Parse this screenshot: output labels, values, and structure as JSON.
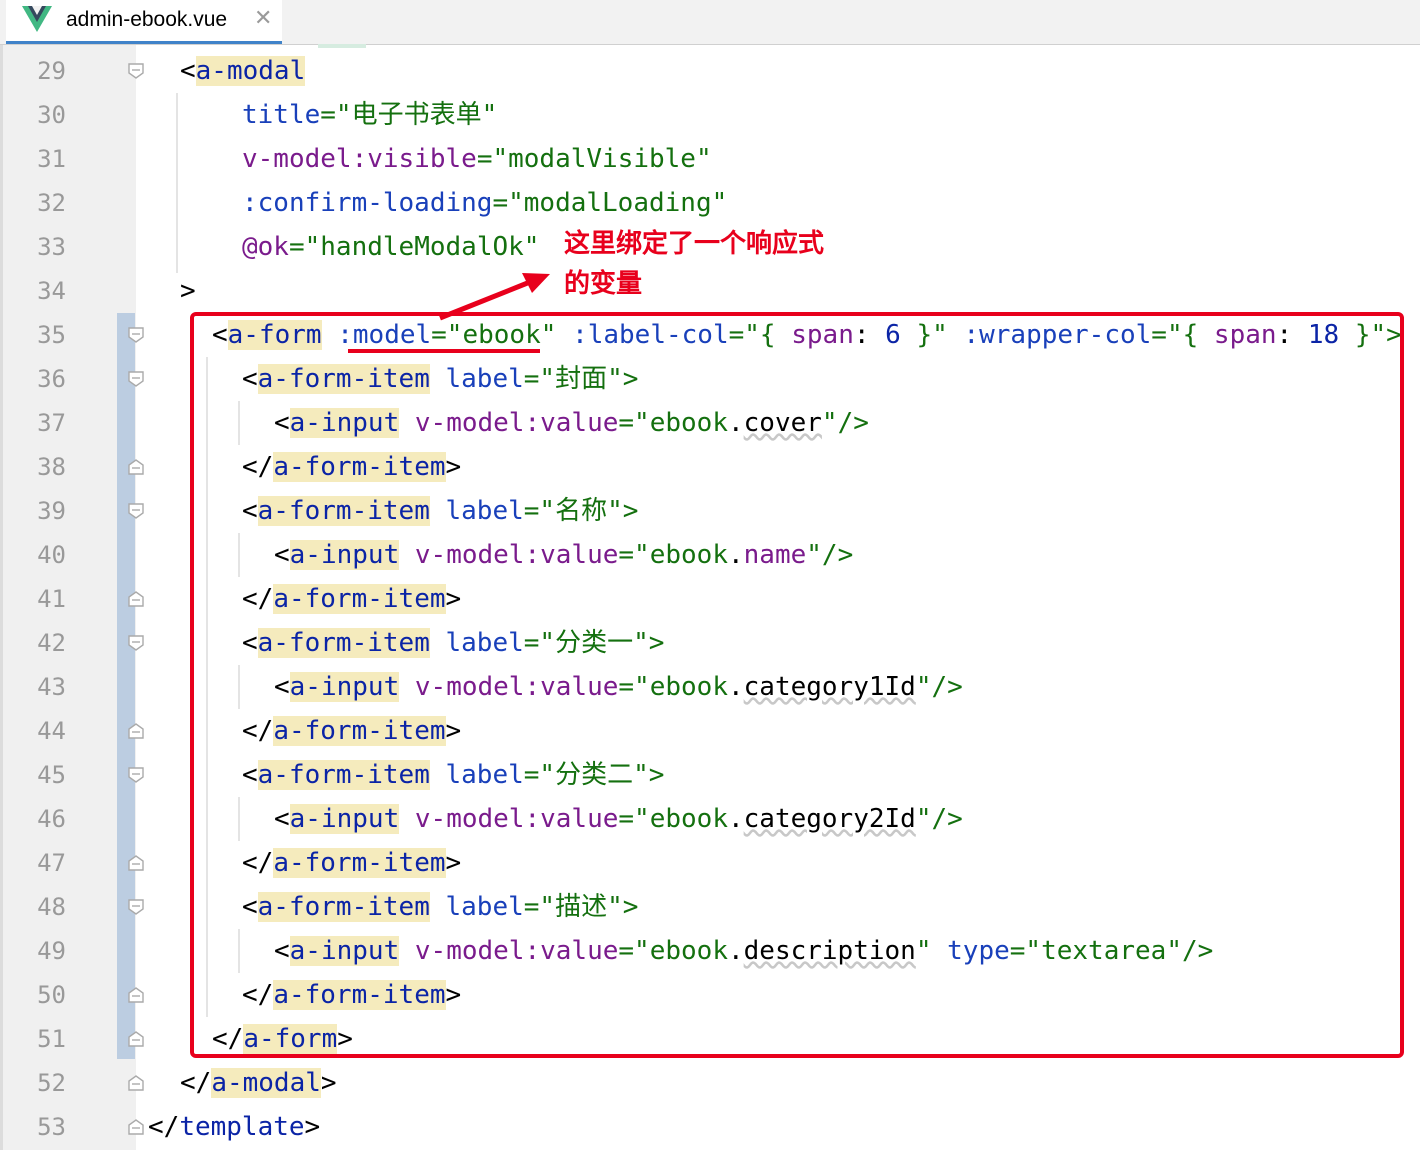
{
  "tab": {
    "filename": "admin-ebook.vue",
    "close": "✕",
    "icon": "vue-logo-icon"
  },
  "line_numbers": [
    "29",
    "30",
    "31",
    "32",
    "33",
    "34",
    "35",
    "36",
    "37",
    "38",
    "39",
    "40",
    "41",
    "42",
    "43",
    "44",
    "45",
    "46",
    "47",
    "48",
    "49",
    "50",
    "51",
    "52",
    "53"
  ],
  "code": {
    "l29": {
      "lt": "<",
      "tag": "a-modal"
    },
    "l30": {
      "attr": "title",
      "eq": "=\"",
      "val": "电子书表单",
      "end": "\""
    },
    "l31": {
      "attr": "v-model:visible",
      "eq": "=\"",
      "val": "modalVisible",
      "end": "\""
    },
    "l32": {
      "attr": ":confirm-loading",
      "eq": "=\"",
      "val": "modalLoading",
      "end": "\""
    },
    "l33": {
      "attr": "@ok",
      "eq": "=\"",
      "val": "handleModalOk",
      "end": "\""
    },
    "l34": {
      "gt": ">"
    },
    "l35": {
      "lt": "<",
      "tag": "a-form",
      "attr1": ":model",
      "q1": "=\"",
      "val1": "ebook",
      "q1e": "\"",
      "attr2": ":label-col",
      "q2": "=\"{ ",
      "key2": "span",
      ":": ": ",
      "num2": "6",
      "q2e": " }\"",
      "attr3": ":wrapper-col",
      "q3": "=\"{ ",
      "key3": "span",
      "num3": "18",
      "q3e": " }\">"
    },
    "l36": {
      "lt": "<",
      "tag": "a-form-item",
      "attr": "label",
      "eq": "=\"",
      "val": "封面",
      "end": "\">"
    },
    "l37": {
      "lt": "<",
      "tag": "a-input",
      "attr": "v-model:value",
      "eq": "=\"",
      "obj": "ebook",
      "dot": ".",
      "prop": "cover",
      "end": "\"/>"
    },
    "l38": {
      "lt": "</",
      "tag": "a-form-item",
      "gt": ">"
    },
    "l39": {
      "lt": "<",
      "tag": "a-form-item",
      "attr": "label",
      "eq": "=\"",
      "val": "名称",
      "end": "\">"
    },
    "l40": {
      "lt": "<",
      "tag": "a-input",
      "attr": "v-model:value",
      "eq": "=\"",
      "obj": "ebook",
      "dot": ".",
      "prop": "name",
      "end": "\"/>"
    },
    "l41": {
      "lt": "</",
      "tag": "a-form-item",
      "gt": ">"
    },
    "l42": {
      "lt": "<",
      "tag": "a-form-item",
      "attr": "label",
      "eq": "=\"",
      "val": "分类一",
      "end": "\">"
    },
    "l43": {
      "lt": "<",
      "tag": "a-input",
      "attr": "v-model:value",
      "eq": "=\"",
      "obj": "ebook",
      "dot": ".",
      "prop": "category1Id",
      "end": "\"/>"
    },
    "l44": {
      "lt": "</",
      "tag": "a-form-item",
      "gt": ">"
    },
    "l45": {
      "lt": "<",
      "tag": "a-form-item",
      "attr": "label",
      "eq": "=\"",
      "val": "分类二",
      "end": "\">"
    },
    "l46": {
      "lt": "<",
      "tag": "a-input",
      "attr": "v-model:value",
      "eq": "=\"",
      "obj": "ebook",
      "dot": ".",
      "prop": "category2Id",
      "end": "\"/>"
    },
    "l47": {
      "lt": "</",
      "tag": "a-form-item",
      "gt": ">"
    },
    "l48": {
      "lt": "<",
      "tag": "a-form-item",
      "attr": "label",
      "eq": "=\"",
      "val": "描述",
      "end": "\">"
    },
    "l49": {
      "lt": "<",
      "tag": "a-input",
      "attr": "v-model:value",
      "eq": "=\"",
      "obj": "ebook",
      "dot": ".",
      "prop": "description",
      "q": "\" ",
      "attr2": "type",
      "eq2": "=\"",
      "val2": "textarea",
      "end": "\"/>"
    },
    "l50": {
      "lt": "</",
      "tag": "a-form-item",
      "gt": ">"
    },
    "l51": {
      "lt": "</",
      "tag": "a-form",
      "gt": ">"
    },
    "l52": {
      "lt": "</",
      "tag": "a-modal",
      "gt": ">"
    },
    "l53": {
      "lt": "</",
      "tag": "template",
      "gt": ">"
    }
  },
  "annotation": {
    "line1": "这里绑定了一个响应式",
    "line2": "的变量"
  },
  "colors": {
    "annotation_red": "#e8001c",
    "tag": "#0b24a6",
    "string": "#14700f",
    "attr_purple": "#7a1b8c",
    "tag_highlight": "#f5ebbd",
    "change_bar": "#bccde1"
  }
}
